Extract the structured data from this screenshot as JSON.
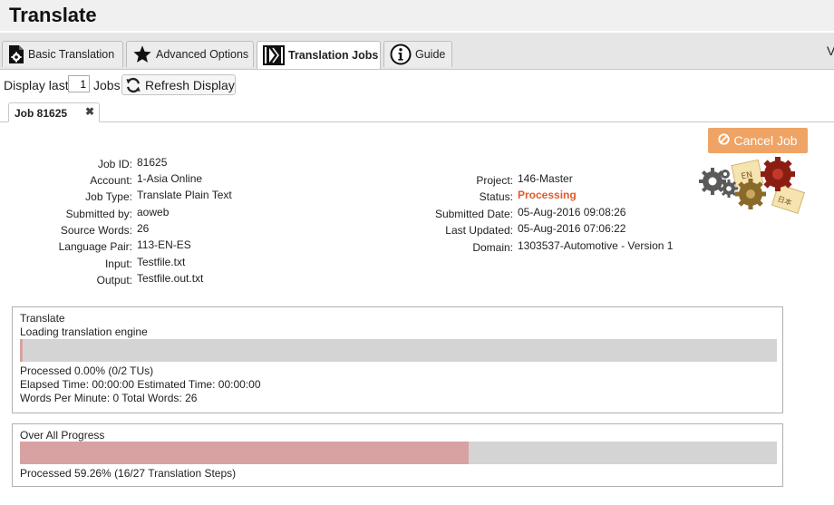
{
  "app": {
    "title": "Translate"
  },
  "tabs": [
    {
      "label": "Basic Translation",
      "icon": "file-gear-icon"
    },
    {
      "label": "Advanced Options",
      "icon": "star-icon"
    },
    {
      "label": "Translation Jobs",
      "icon": "film-strip-icon",
      "active": true
    },
    {
      "label": "Guide",
      "icon": "info-circle-icon"
    }
  ],
  "tabbar_edge_text": "V",
  "toolbar": {
    "display_label": "Display last",
    "count_value": "1",
    "jobs_label": "Jobs",
    "refresh_label": "Refresh Display"
  },
  "job_tab": {
    "label": "Job 81625",
    "close_glyph": "✖"
  },
  "cancel_button": {
    "label": "Cancel Job",
    "color": "#efa466"
  },
  "job": {
    "left": [
      {
        "label": "Job ID:",
        "value": "81625"
      },
      {
        "label": "Account:",
        "value": "1-Asia Online"
      },
      {
        "label": "Job Type:",
        "value": "Translate Plain Text"
      },
      {
        "label": "Submitted by:",
        "value": "aoweb"
      },
      {
        "label": "Source Words:",
        "value": "26"
      },
      {
        "label": "Language Pair:",
        "value": "113-EN-ES"
      },
      {
        "label": "Input:",
        "value": "Testfile.txt"
      },
      {
        "label": "Output:",
        "value": "Testfile.out.txt"
      }
    ],
    "right": [
      {
        "label": "Project:",
        "value": "146-Master"
      },
      {
        "label": "Status:",
        "value": "Processing"
      },
      {
        "label": "Submitted Date:",
        "value": "05-Aug-2016 09:08:26"
      },
      {
        "label": "Last Updated:",
        "value": "05-Aug-2016 07:06:22"
      },
      {
        "label": "Domain:",
        "value": "1303537-Automotive - Version 1"
      }
    ],
    "status_color": "#e05a2b"
  },
  "gear_labels": {
    "en": "EN",
    "ja": "日本"
  },
  "translate_panel": {
    "title": "Translate",
    "stage": "Loading translation engine",
    "progress_fraction": 0.002,
    "processed": "Processed 0.00% (0/2 TUs)",
    "elapsed": "Elapsed Time: 00:00:00 Estimated Time: 00:00:00",
    "words": "Words Per Minute: 0 Total Words: 26"
  },
  "overall_panel": {
    "title": "Over All Progress",
    "progress_fraction": 0.5926,
    "processed": "Processed 59.26% (16/27 Translation Steps)"
  },
  "colors": {
    "progress_fill": "#d9a2a2",
    "progress_track": "#d4d4d4"
  }
}
